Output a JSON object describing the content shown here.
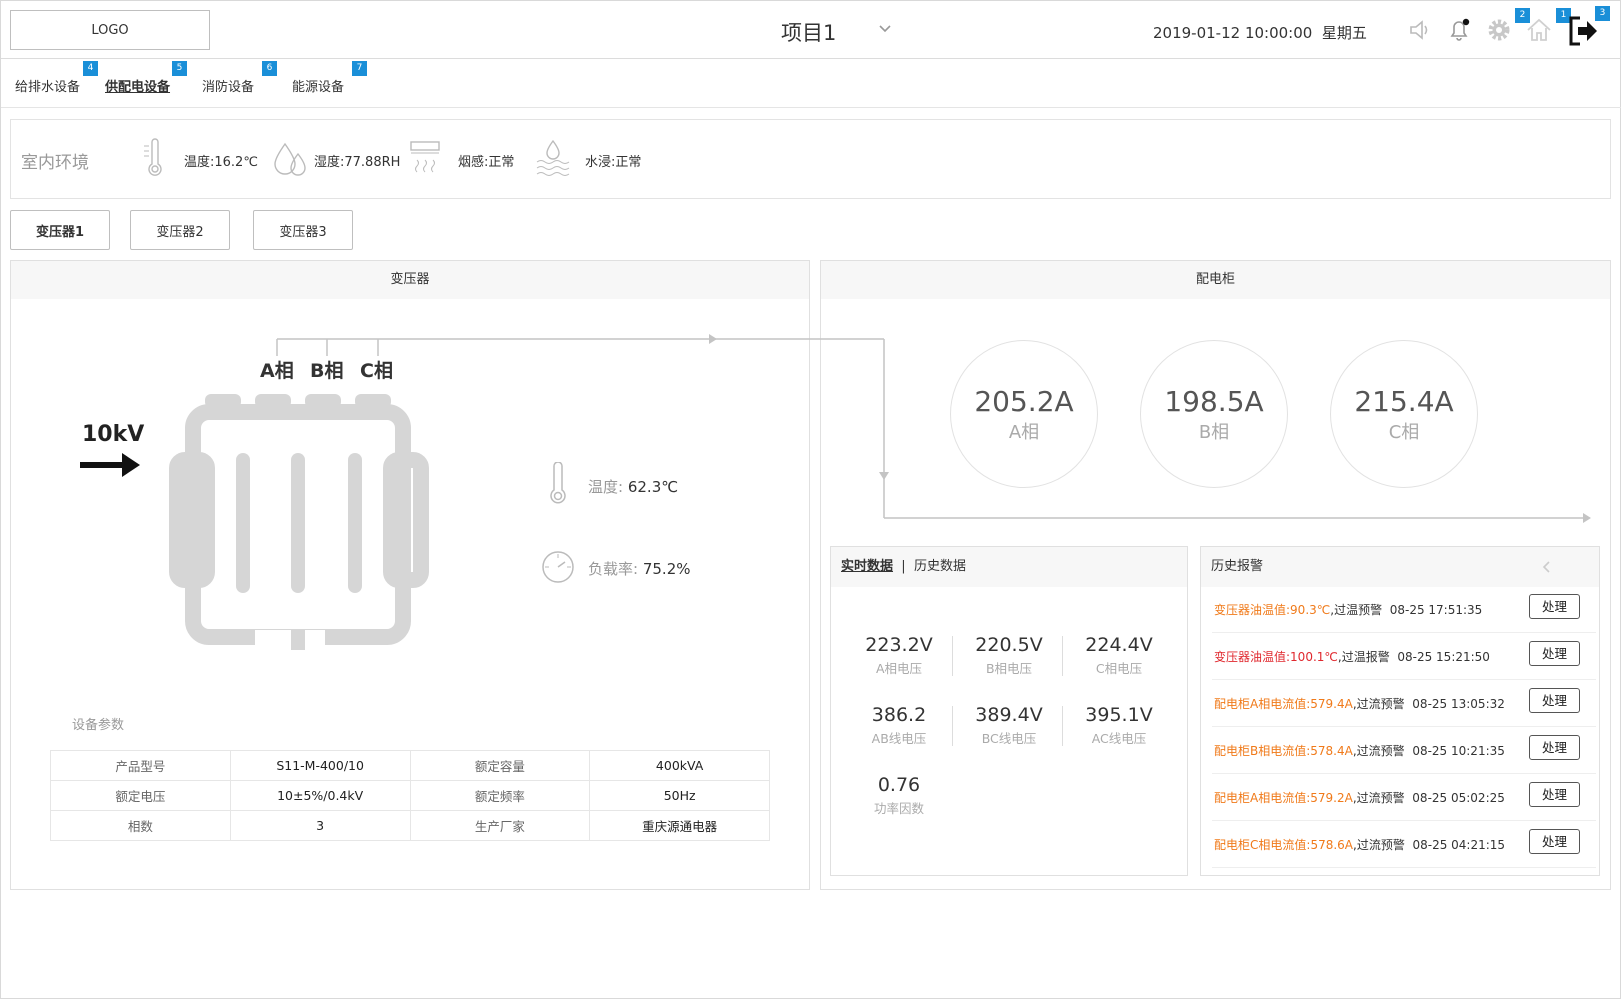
{
  "header": {
    "logo": "LOGO",
    "project": "项目1",
    "datetime": "2019-01-12 10:00:00",
    "weekday": "星期五",
    "badges": {
      "settings": "2",
      "home": "1",
      "logout": "3"
    }
  },
  "nav": {
    "items": [
      {
        "label": "给排水设备",
        "badge": "4"
      },
      {
        "label": "供配电设备",
        "badge": "5"
      },
      {
        "label": "消防设备",
        "badge": "6"
      },
      {
        "label": "能源设备",
        "badge": "7"
      }
    ]
  },
  "env": {
    "title": "室内环境",
    "temperature": "温度:16.2℃",
    "humidity": "湿度:77.88RH",
    "smoke": "烟感:正常",
    "water": "水浸:正常"
  },
  "tabs": [
    "变压器1",
    "变压器2",
    "变压器3"
  ],
  "transformer": {
    "title": "变压器",
    "phases": [
      "A相",
      "B相",
      "C相"
    ],
    "input_voltage": "10kV",
    "temp_label": "温度:",
    "temp_value": "62.3℃",
    "load_label": "负载率:",
    "load_value": "75.2%",
    "params_title": "设备参数",
    "params": [
      [
        "产品型号",
        "S11-M-400/10",
        "额定容量",
        "400kVA"
      ],
      [
        "额定电压",
        "10±5%/0.4kV",
        "额定频率",
        "50Hz"
      ],
      [
        "相数",
        "3",
        "生产厂家",
        "重庆源通电器"
      ]
    ]
  },
  "cabinet": {
    "title": "配电柜",
    "currents": [
      {
        "value": "205.2A",
        "phase": "A相"
      },
      {
        "value": "198.5A",
        "phase": "B相"
      },
      {
        "value": "215.4A",
        "phase": "C相"
      }
    ]
  },
  "realtime": {
    "tab_current": "实时数据",
    "separator": "|",
    "tab_history": "历史数据",
    "metrics": [
      {
        "value": "223.2V",
        "label": "A相电压"
      },
      {
        "value": "220.5V",
        "label": "B相电压"
      },
      {
        "value": "224.4V",
        "label": "C相电压"
      },
      {
        "value": "386.2",
        "label": "AB线电压"
      },
      {
        "value": "389.4V",
        "label": "BC线电压"
      },
      {
        "value": "395.1V",
        "label": "AC线电压"
      },
      {
        "value": "0.76",
        "label": "功率因数"
      }
    ]
  },
  "alarms": {
    "title": "历史报警",
    "button_label": "处理",
    "items": [
      {
        "name": "变压器油温值:",
        "value": "90.3℃",
        "desc": ",过温预警",
        "time": "08-25 17:51:35",
        "color": "orange"
      },
      {
        "name": "变压器油温值:",
        "value": "100.1℃",
        "desc": ",过温报警",
        "time": "08-25 15:21:50",
        "color": "red"
      },
      {
        "name": "配电柜A相电流值:",
        "value": "579.4A",
        "desc": ",过流预警",
        "time": "08-25 13:05:32",
        "color": "orange"
      },
      {
        "name": "配电柜B相电流值:",
        "value": "578.4A",
        "desc": ",过流预警",
        "time": "08-25 10:21:35",
        "color": "orange"
      },
      {
        "name": "配电柜A相电流值:",
        "value": "579.2A",
        "desc": ",过流预警",
        "time": "08-25 05:02:25",
        "color": "orange"
      },
      {
        "name": "配电柜C相电流值:",
        "value": "578.6A",
        "desc": ",过流预警",
        "time": "08-25 04:21:15",
        "color": "orange"
      }
    ]
  },
  "colors": {
    "accent": "#1a8fd8",
    "warning": "#f07a1a",
    "alarm": "#e0282e"
  }
}
